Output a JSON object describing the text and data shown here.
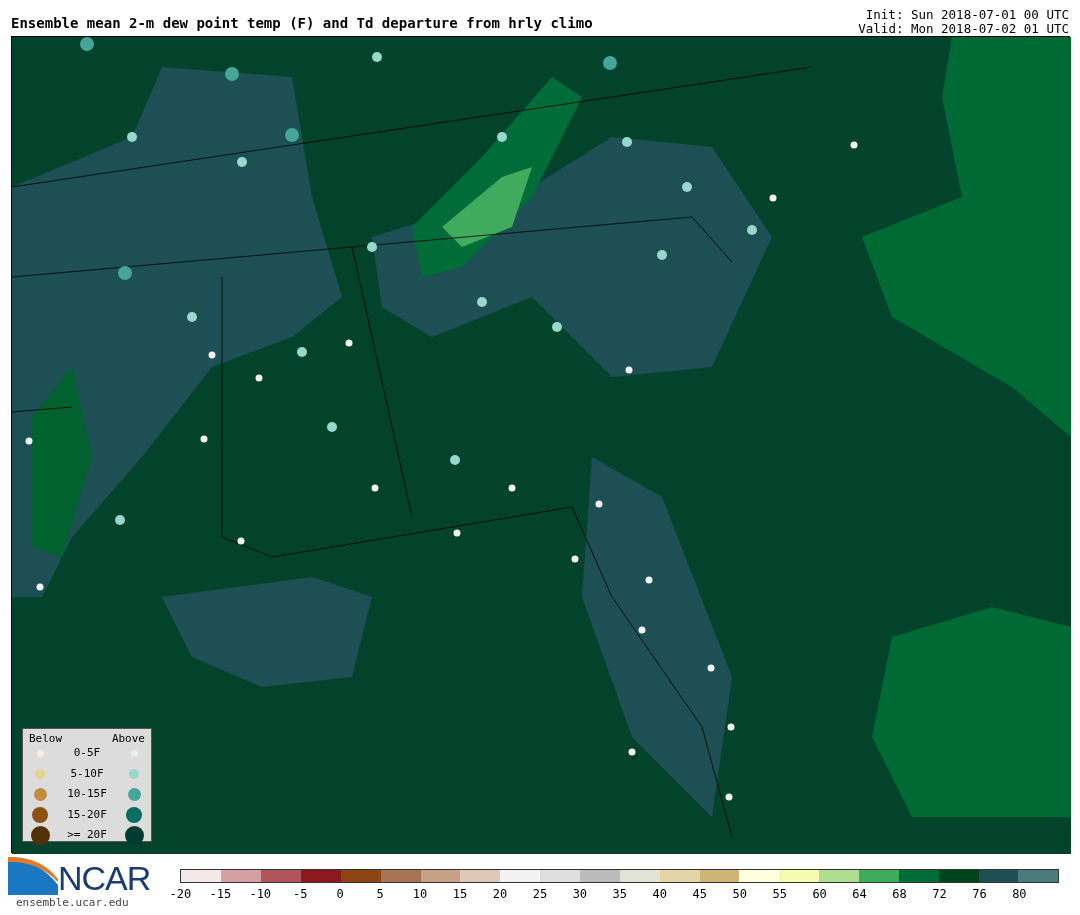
{
  "title": "Ensemble mean 2-m dew point temp (F) and Td departure from hrly climo",
  "init": "Init: Sun 2018-07-01 00 UTC",
  "valid": "Valid: Mon 2018-07-02 01 UTC",
  "legend": {
    "below_heading": "Below",
    "above_heading": "Above",
    "rows": [
      {
        "label": "0-5F",
        "below": {
          "color": "#fbeedd"
        },
        "above": {
          "color": "#e0f3f0"
        }
      },
      {
        "label": "5-10F",
        "below": {
          "color": "#e8d08f"
        },
        "above": {
          "color": "#98d8cc"
        }
      },
      {
        "label": "10-15F",
        "below": {
          "color": "#c68c3e"
        },
        "above": {
          "color": "#45a596"
        }
      },
      {
        "label": "15-20F",
        "below": {
          "color": "#8b5111"
        },
        "above": {
          "color": "#076c61"
        }
      },
      {
        "label": ">= 20F",
        "below": {
          "color": "#533008"
        },
        "above": {
          "color": "#013a30"
        }
      }
    ]
  },
  "logo": {
    "name": "NCAR",
    "url": "ensemble.ucar.edu"
  },
  "colorbar": {
    "bins": [
      {
        "color": "#f5e8e8"
      },
      {
        "color": "#d4a0a4"
      },
      {
        "color": "#b05558"
      },
      {
        "color": "#8b1a1e"
      },
      {
        "color": "#8b4513"
      },
      {
        "color": "#a87552"
      },
      {
        "color": "#c8a085"
      },
      {
        "color": "#e0c8b8"
      },
      {
        "color": "#f2f2f2"
      },
      {
        "color": "#dedede"
      },
      {
        "color": "#bbbbbb"
      },
      {
        "color": "#e3e3d5"
      },
      {
        "color": "#e5d4a8"
      },
      {
        "color": "#cfb478"
      },
      {
        "color": "#ffffe0"
      },
      {
        "color": "#f5fcb0"
      },
      {
        "color": "#aede90"
      },
      {
        "color": "#41ab5d"
      },
      {
        "color": "#006d38"
      },
      {
        "color": "#00441b"
      },
      {
        "color": "#1d4f54"
      },
      {
        "color": "#4a7a7c"
      }
    ],
    "ticks": [
      "-20",
      "-15",
      "-10",
      "-5",
      "0",
      "5",
      "10",
      "15",
      "20",
      "25",
      "30",
      "35",
      "40",
      "45",
      "50",
      "55",
      "60",
      "64",
      "68",
      "72",
      "76",
      "80"
    ]
  }
}
